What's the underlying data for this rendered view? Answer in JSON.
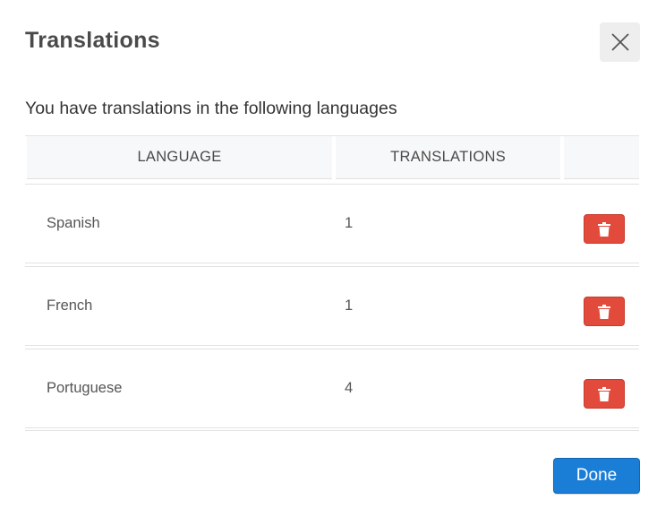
{
  "dialog": {
    "title": "Translations",
    "close_icon": "close-icon",
    "intro": "You have translations in the following languages",
    "done_label": "Done"
  },
  "table": {
    "headers": {
      "language": "LANGUAGE",
      "translations": "TRANSLATIONS",
      "actions": ""
    },
    "rows": [
      {
        "language": "Spanish",
        "translations": "1",
        "action_icon": "trash-icon"
      },
      {
        "language": "French",
        "translations": "1",
        "action_icon": "trash-icon"
      },
      {
        "language": "Portuguese",
        "translations": "4",
        "action_icon": "trash-icon"
      }
    ]
  },
  "colors": {
    "danger": "#e24b3b",
    "primary": "#1b7ed6",
    "header_bg": "#f7f8f9",
    "close_bg": "#eeeeee"
  }
}
